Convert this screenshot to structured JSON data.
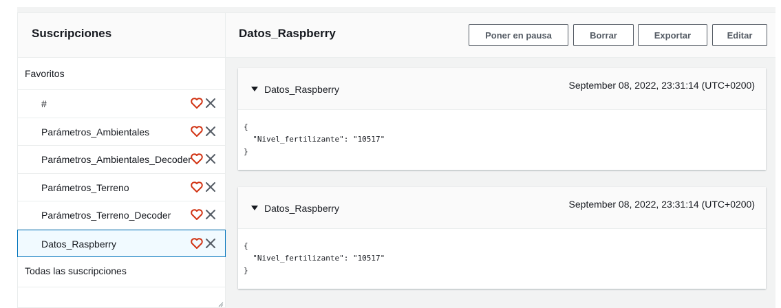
{
  "left_panel": {
    "title": "Suscripciones",
    "favorites_label": "Favoritos",
    "subscriptions": [
      {
        "label": "#"
      },
      {
        "label": "Parámetros_Ambientales"
      },
      {
        "label": "Parámetros_Ambientales_Decoder"
      },
      {
        "label": "Parámetros_Terreno"
      },
      {
        "label": "Parámetros_Terreno_Decoder"
      },
      {
        "label": "Datos_Raspberry",
        "selected": true
      }
    ],
    "all_label": "Todas las suscripciones"
  },
  "right_panel": {
    "title": "Datos_Raspberry",
    "buttons": {
      "pause": "Poner en pausa",
      "clear": "Borrar",
      "export": "Exportar",
      "edit": "Editar"
    },
    "messages": [
      {
        "topic": "Datos_Raspberry",
        "timestamp": "September 08, 2022, 23:31:14 (UTC+0200)",
        "payload": "{\n  \"Nivel_fertilizante\": \"10517\"\n}"
      },
      {
        "topic": "Datos_Raspberry",
        "timestamp": "September 08, 2022, 23:31:14 (UTC+0200)",
        "payload": "{\n  \"Nivel_fertilizante\": \"10517\"\n}"
      }
    ]
  },
  "colors": {
    "heart": "#d13212",
    "close": "#545b64",
    "selected_border": "#0073bb",
    "header_bg": "#fafafa",
    "body_bg": "#f2f3f3"
  },
  "icons": {
    "favorite": "heart-outline-icon",
    "remove": "close-icon",
    "expand": "caret-down-icon",
    "resize": "resize-grip-icon"
  }
}
